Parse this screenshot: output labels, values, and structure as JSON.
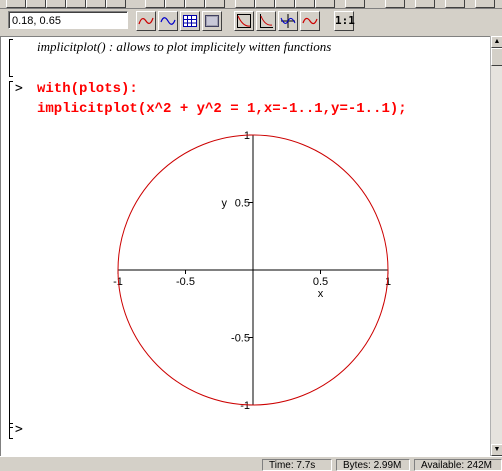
{
  "toolbar": {
    "coordinate_readout": "0.18, 0.65",
    "buttons": [
      {
        "name": "curve-style-1-icon"
      },
      {
        "name": "curve-style-2-icon"
      },
      {
        "name": "grid-style-1-icon"
      },
      {
        "name": "grid-style-2-icon"
      },
      {
        "name": "axes-boxed-icon"
      },
      {
        "name": "axes-framed-icon"
      },
      {
        "name": "axes-normal-icon"
      },
      {
        "name": "axes-none-icon"
      },
      {
        "name": "scaling-constrained-label",
        "label": "1:1"
      }
    ]
  },
  "worksheet": {
    "comment": "implicitplot() : allows to plot implicitely witten functions",
    "prompt_symbol": ">",
    "code_lines": [
      "with(plots):",
      "implicitplot(x^2 + y^2 = 1,x=-1..1,y=-1..1);"
    ],
    "empty_prompt": ">"
  },
  "chart_data": {
    "type": "line",
    "title": "",
    "xlabel": "x",
    "ylabel": "y",
    "xlim": [
      -1,
      1
    ],
    "ylim": [
      -1,
      1
    ],
    "x_ticks": [
      "-1",
      "-0.5",
      "0.5",
      "1"
    ],
    "y_ticks": [
      "1",
      "0.5",
      "-0.5",
      "-1"
    ],
    "series": [
      {
        "equation": "x^2 + y^2 = 1",
        "shape": "unit circle",
        "color": "#cc0000"
      }
    ],
    "grid": false
  },
  "status_bar": {
    "time": "Time: 7.7s",
    "bytes": "Bytes: 2.99M",
    "available": "Available: 242M"
  },
  "colors": {
    "code_red": "#ff0000",
    "curve_red": "#cc0000",
    "chrome_gray": "#d4d0c8"
  }
}
